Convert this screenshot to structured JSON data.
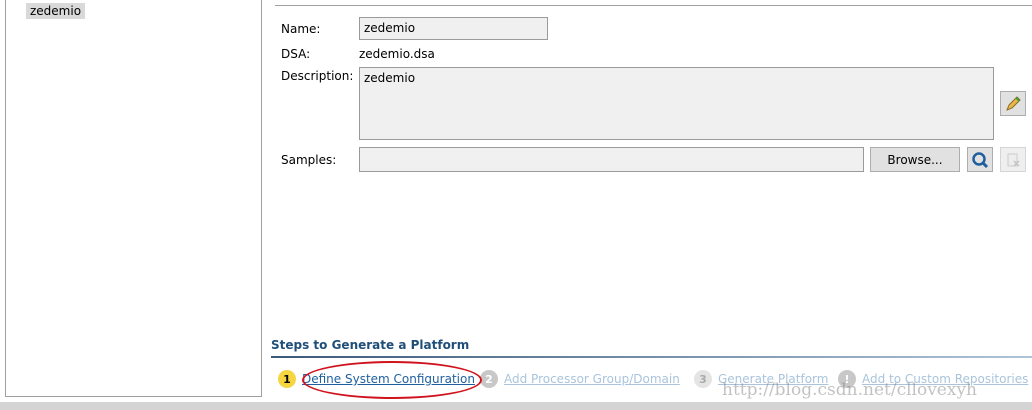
{
  "tree": {
    "items": [
      "zedemio"
    ]
  },
  "form": {
    "name_label": "Name:",
    "name_value": "zedemio",
    "dsa_label": "DSA:",
    "dsa_value": "zedemio.dsa",
    "description_label": "Description:",
    "description_value": "zedemio",
    "samples_label": "Samples:",
    "samples_value": "",
    "browse_label": "Browse..."
  },
  "steps": {
    "title": "Steps to Generate a Platform",
    "items": [
      {
        "num": "1",
        "label": "Define System Configuration",
        "active": true
      },
      {
        "num": "2",
        "label": "Add Processor Group/Domain",
        "active": false
      },
      {
        "num": "3",
        "label": "Generate Platform",
        "active": false
      },
      {
        "num": "!",
        "label": "Add to Custom Repositories",
        "active": false
      }
    ]
  },
  "watermark": "http://blog.csdn.net/cllovexyh",
  "colors": {
    "active_link": "#1f5f9f",
    "inactive_link": "#a9c4dc",
    "annotation": "#d0131c"
  }
}
